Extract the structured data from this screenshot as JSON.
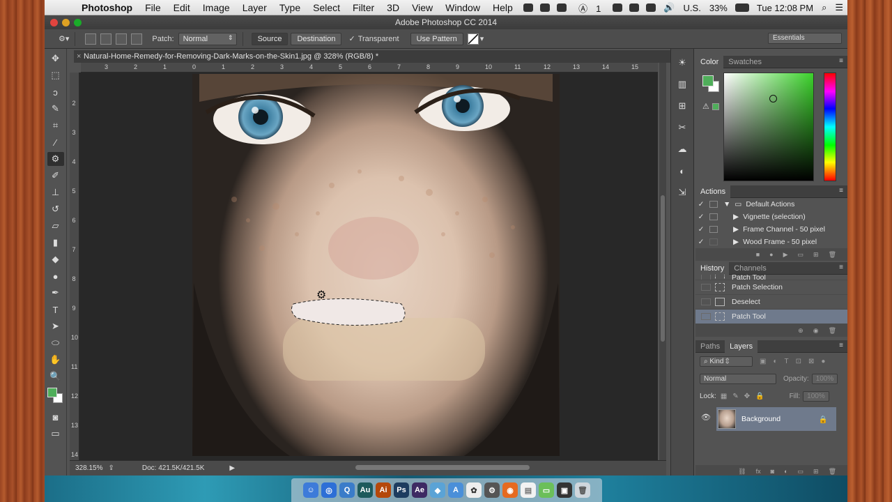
{
  "menubar": {
    "app_name": "Photoshop",
    "items": [
      "File",
      "Edit",
      "Image",
      "Layer",
      "Type",
      "Select",
      "Filter",
      "3D",
      "View",
      "Window",
      "Help"
    ],
    "tray": {
      "input_source": "U.S.",
      "battery": "33%",
      "clock": "Tue 12:08 PM",
      "adobe_badge": "1"
    }
  },
  "window": {
    "title": "Adobe Photoshop CC 2014"
  },
  "options": {
    "patch_label": "Patch:",
    "patch_mode": "Normal",
    "source": "Source",
    "destination": "Destination",
    "transparent": "Transparent",
    "use_pattern": "Use Pattern",
    "workspace": "Essentials"
  },
  "document": {
    "tab_title": "Natural-Home-Remedy-for-Removing-Dark-Marks-on-the-Skin1.jpg @ 328% (RGB/8) *",
    "zoom": "328.15%",
    "doc_size": "Doc: 421.5K/421.5K",
    "ruler_h": [
      "3",
      "2",
      "1",
      "0",
      "1",
      "2",
      "3",
      "4",
      "5",
      "6",
      "7",
      "8",
      "9",
      "10",
      "11",
      "12",
      "13",
      "14",
      "15"
    ],
    "ruler_v": [
      "2",
      "3",
      "4",
      "5",
      "6",
      "7",
      "8",
      "9",
      "10",
      "11",
      "12",
      "13",
      "14"
    ]
  },
  "color_panel": {
    "tabs": [
      "Color",
      "Swatches"
    ],
    "foreground": "#4fae5a",
    "background": "#ffffff"
  },
  "actions_panel": {
    "title": "Actions",
    "items": [
      {
        "label": "Default Actions",
        "type": "folder"
      },
      {
        "label": "Vignette (selection)",
        "type": "action"
      },
      {
        "label": "Frame Channel - 50 pixel",
        "type": "action"
      },
      {
        "label": "Wood Frame - 50 pixel",
        "type": "action"
      }
    ]
  },
  "history_panel": {
    "tabs": [
      "History",
      "Channels"
    ],
    "items": [
      "Patch Tool",
      "Patch Selection",
      "Deselect",
      "Patch Tool"
    ],
    "selected_index": 3
  },
  "layers_panel": {
    "tabs": [
      "Paths",
      "Layers"
    ],
    "filter": "Kind",
    "blend_mode": "Normal",
    "opacity_label": "Opacity:",
    "opacity": "100%",
    "lock_label": "Lock:",
    "fill_label": "Fill:",
    "fill": "100%",
    "layers": [
      {
        "name": "Background",
        "locked": true,
        "visible": true
      }
    ]
  },
  "dock": {
    "apps": [
      {
        "label": "Au",
        "color": "#1d5a5c"
      },
      {
        "label": "Ai",
        "color": "#b5480a"
      },
      {
        "label": "Ps",
        "color": "#1d3c5f"
      },
      {
        "label": "Ae",
        "color": "#3e2a63"
      }
    ]
  }
}
